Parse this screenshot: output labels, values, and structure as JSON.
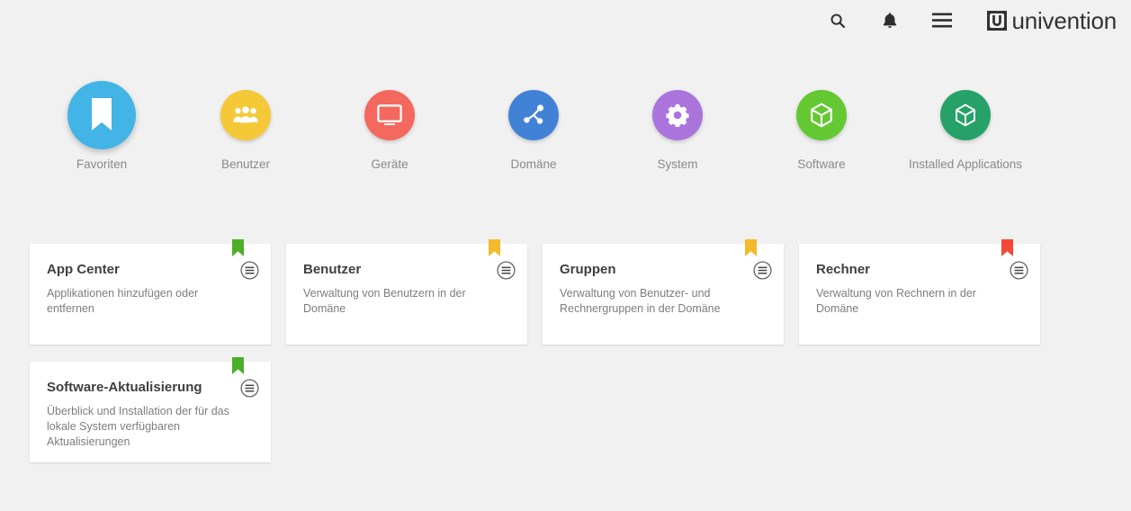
{
  "header": {
    "brand": "univention",
    "brand_logo_icon": "univention-u-logo",
    "actions": [
      {
        "name": "search-button",
        "icon": "search-icon",
        "label": "Search"
      },
      {
        "name": "notifications-button",
        "icon": "bell-icon",
        "label": "Notifications"
      },
      {
        "name": "menu-button",
        "icon": "hamburger-menu-icon",
        "label": "Menu"
      }
    ]
  },
  "categories": [
    {
      "label": "Favoriten",
      "icon": "bookmark-icon",
      "color": "#42b4e6",
      "selected": true
    },
    {
      "label": "Benutzer",
      "icon": "users-icon",
      "color": "#f5c838",
      "selected": false
    },
    {
      "label": "Geräte",
      "icon": "monitor-icon",
      "color": "#f4685e",
      "selected": false
    },
    {
      "label": "Domäne",
      "icon": "share-nodes-icon",
      "color": "#4182d6",
      "selected": false
    },
    {
      "label": "System",
      "icon": "gear-icon",
      "color": "#ab74dd",
      "selected": false
    },
    {
      "label": "Software",
      "icon": "cube-icon",
      "color": "#64c832",
      "selected": false
    },
    {
      "label": "Installed Applications",
      "icon": "cube-icon",
      "color": "#26a269",
      "selected": false
    }
  ],
  "cards": [
    {
      "title": "App Center",
      "description": "Applikationen hinzufügen oder entfernen",
      "ribbon_color": "#4caf28",
      "menu_icon": "circle-hamburger-menu-icon"
    },
    {
      "title": "Benutzer",
      "description": "Verwaltung von Benutzern in der Domäne",
      "ribbon_color": "#f5b92c",
      "menu_icon": "circle-hamburger-menu-icon"
    },
    {
      "title": "Gruppen",
      "description": "Verwaltung von Benutzer- und Rechnergruppen in der Domäne",
      "ribbon_color": "#f5b92c",
      "menu_icon": "circle-hamburger-menu-icon"
    },
    {
      "title": "Rechner",
      "description": "Verwaltung von Rechnern in der Domäne",
      "ribbon_color": "#f4483a",
      "menu_icon": "circle-hamburger-menu-icon"
    },
    {
      "title": "Software-Aktualisierung",
      "description": "Überblick und Installation der für das lokale System verfügbaren Aktualisierungen",
      "ribbon_color": "#4caf28",
      "menu_icon": "circle-hamburger-menu-icon"
    }
  ],
  "colors": {
    "page_background": "#f1f1f1",
    "card_background": "#ffffff",
    "title_text": "#3f3f3f",
    "body_text": "#7d7d7d",
    "category_label": "#8a8a8a"
  }
}
